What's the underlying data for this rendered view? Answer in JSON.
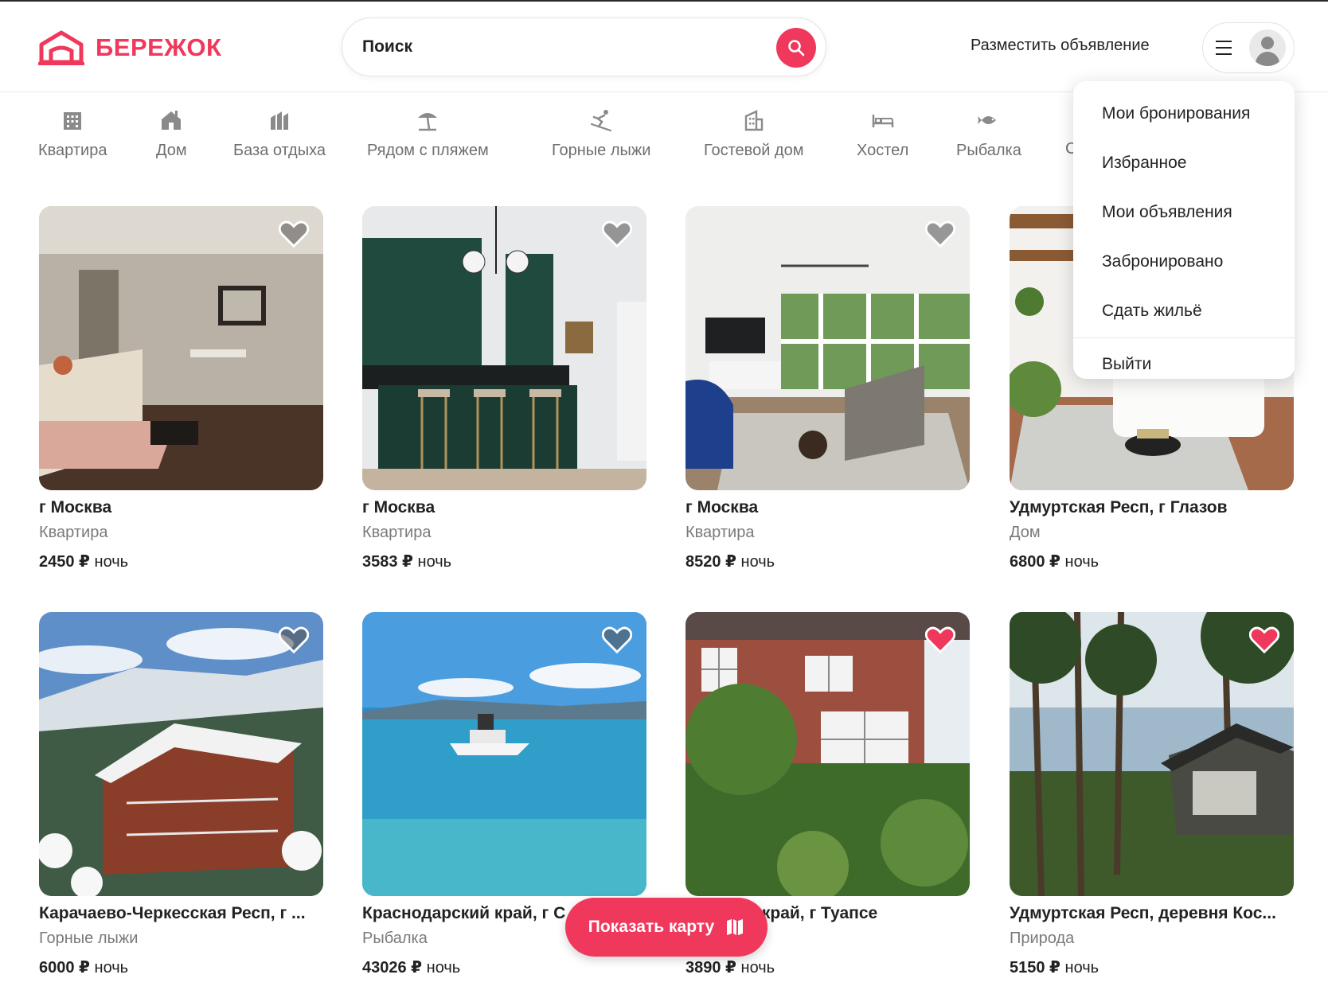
{
  "brand": {
    "name": "БЕРЕЖОК",
    "color": "#f0385c"
  },
  "search": {
    "placeholder": "Поиск",
    "value": ""
  },
  "header": {
    "host_link": "Разместить объявление"
  },
  "categories": [
    {
      "label": "Квартира",
      "icon": "apartment-building-icon"
    },
    {
      "label": "Дом",
      "icon": "house-icon"
    },
    {
      "label": "База отдыха",
      "icon": "resort-icon"
    },
    {
      "label": "Рядом с пляжем",
      "icon": "beach-umbrella-icon"
    },
    {
      "label": "Горные лыжи",
      "icon": "skier-icon"
    },
    {
      "label": "Гостевой дом",
      "icon": "guest-house-icon"
    },
    {
      "label": "Хостел",
      "icon": "bed-icon"
    },
    {
      "label": "Рыбалка",
      "icon": "fish-icon"
    },
    {
      "label": "С",
      "icon": ""
    }
  ],
  "user_menu": {
    "items": [
      "Мои бронирования",
      "Избранное",
      "Мои объявления",
      "Забронировано",
      "Сдать жильё"
    ],
    "logout": "Выйти"
  },
  "listings": [
    {
      "title": "г Москва",
      "type": "Квартира",
      "price": "2450 ₽",
      "unit": "ночь",
      "favorite": false,
      "scene": "living-room"
    },
    {
      "title": "г Москва",
      "type": "Квартира",
      "price": "3583 ₽",
      "unit": "ночь",
      "favorite": false,
      "scene": "kitchen"
    },
    {
      "title": "г Москва",
      "type": "Квартира",
      "price": "8520 ₽",
      "unit": "ночь",
      "favorite": false,
      "scene": "bright-living-room"
    },
    {
      "title": "Удмуртская Респ, г Глазов",
      "type": "Дом",
      "price": "6800 ₽",
      "unit": "ночь",
      "favorite": false,
      "scene": "white-interior"
    },
    {
      "title": "Карачаево-Черкесская Респ, г ...",
      "type": "Горные лыжи",
      "price": "6000 ₽",
      "unit": "ночь",
      "favorite": false,
      "scene": "ski-chalet"
    },
    {
      "title": "Краснодарский край, г С",
      "type": "Рыбалка",
      "price": "43026 ₽",
      "unit": "ночь",
      "favorite": false,
      "scene": "yacht-lake"
    },
    {
      "title": "...арский край, г Туапсе",
      "type": "...дом",
      "price": "3890 ₽",
      "unit": "ночь",
      "favorite": true,
      "scene": "brick-house"
    },
    {
      "title": "Удмуртская Респ, деревня Кос...",
      "type": "Природа",
      "price": "5150 ₽",
      "unit": "ночь",
      "favorite": true,
      "scene": "forest-cabin"
    }
  ],
  "map_button": {
    "label": "Показать карту"
  }
}
